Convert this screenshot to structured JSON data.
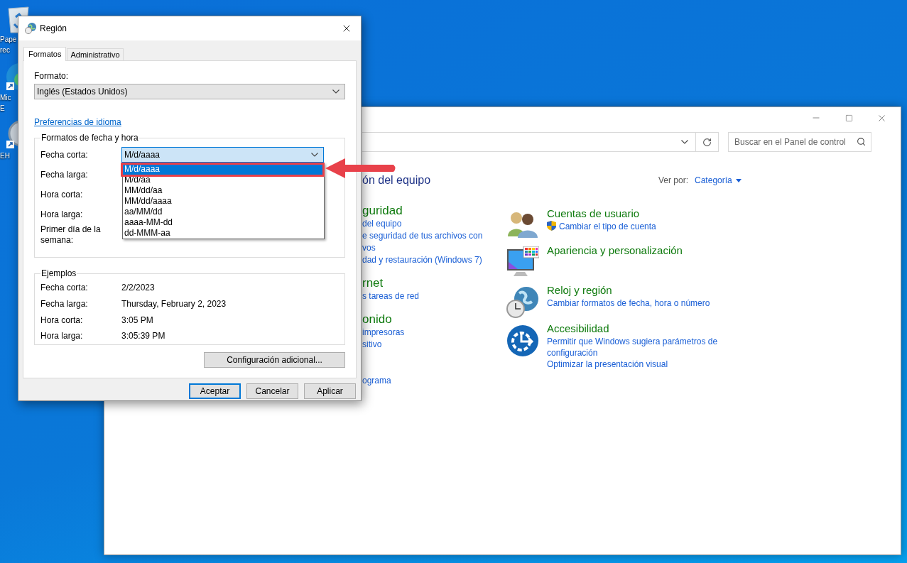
{
  "desktop_icons": [
    {
      "kind": "recycle",
      "label_lines": [
        "Pape",
        "rec"
      ]
    },
    {
      "kind": "browser",
      "label_lines": [
        "Mic",
        "E"
      ]
    },
    {
      "kind": "app",
      "label_lines": [
        "EH"
      ]
    }
  ],
  "control_panel": {
    "search": {
      "placeholder": "Buscar en el Panel de control"
    },
    "heading": "ón del equipo",
    "view_by": {
      "label": "Ver por:",
      "value": "Categoría"
    },
    "categories_left": [
      {
        "heading": "guridad",
        "links": [
          "del equipo",
          "e seguridad de tus archivos con",
          "vos",
          "dad y restauración (Windows 7)"
        ]
      },
      {
        "heading": "rnet",
        "links": [
          "s tareas de red"
        ]
      },
      {
        "heading": "onido",
        "links": [
          "impresoras",
          "sitivo"
        ]
      },
      {
        "links": [
          "ograma"
        ]
      }
    ],
    "categories_right": [
      {
        "kind": "users",
        "heading": "Cuentas de usuario",
        "links": [
          {
            "text": "Cambiar el tipo de cuenta",
            "shield": true
          }
        ]
      },
      {
        "kind": "appearance",
        "heading": "Apariencia y personalización"
      },
      {
        "kind": "clock",
        "heading": "Reloj y región",
        "links": [
          {
            "text": "Cambiar formatos de fecha, hora o número",
            "shield": false
          }
        ]
      },
      {
        "kind": "access",
        "heading": "Accesibilidad",
        "links": [
          {
            "text": "Permitir que Windows sugiera parámetros de configuración",
            "shield": false
          },
          {
            "text": "Optimizar la presentación visual",
            "shield": false
          }
        ]
      }
    ]
  },
  "region_dialog": {
    "title": "Región",
    "tabs": [
      {
        "label": "Formatos",
        "selected": true
      },
      {
        "label": "Administrativo",
        "selected": false
      }
    ],
    "format": {
      "label": "Formato:",
      "value": "Inglés (Estados Unidos)"
    },
    "language_link": "Preferencias de idioma",
    "date_time_formats": {
      "title": "Formatos de fecha y hora",
      "rows": [
        {
          "label": "Fecha corta:",
          "value": "M/d/aaaa",
          "focused": true
        },
        {
          "label": "Fecha larga:"
        },
        {
          "label": "Hora corta:"
        },
        {
          "label": "Hora larga:"
        },
        {
          "label": "Primer día de la semana:"
        }
      ]
    },
    "dropdown": {
      "options": [
        {
          "text": "M/d/aaaa",
          "selected": true
        },
        {
          "text": "M/d/aa",
          "selected": false
        },
        {
          "text": "MM/dd/aa",
          "selected": false
        },
        {
          "text": "MM/dd/aaaa",
          "selected": false
        },
        {
          "text": "aa/MM/dd",
          "selected": false
        },
        {
          "text": "aaaa-MM-dd",
          "selected": false
        },
        {
          "text": "dd-MMM-aa",
          "selected": false
        }
      ]
    },
    "examples": {
      "title": "Ejemplos",
      "rows": [
        {
          "label": "Fecha corta:",
          "value": "2/2/2023"
        },
        {
          "label": "Fecha larga:",
          "value": "Thursday, February 2, 2023"
        },
        {
          "label": "Hora corta:",
          "value": "3:05 PM"
        },
        {
          "label": "Hora larga:",
          "value": "3:05:39 PM"
        }
      ]
    },
    "additional_button": "Configuración adicional...",
    "buttons": [
      {
        "label": "Aceptar",
        "default": true
      },
      {
        "label": "Cancelar",
        "default": false
      },
      {
        "label": "Aplicar",
        "default": false
      }
    ]
  }
}
